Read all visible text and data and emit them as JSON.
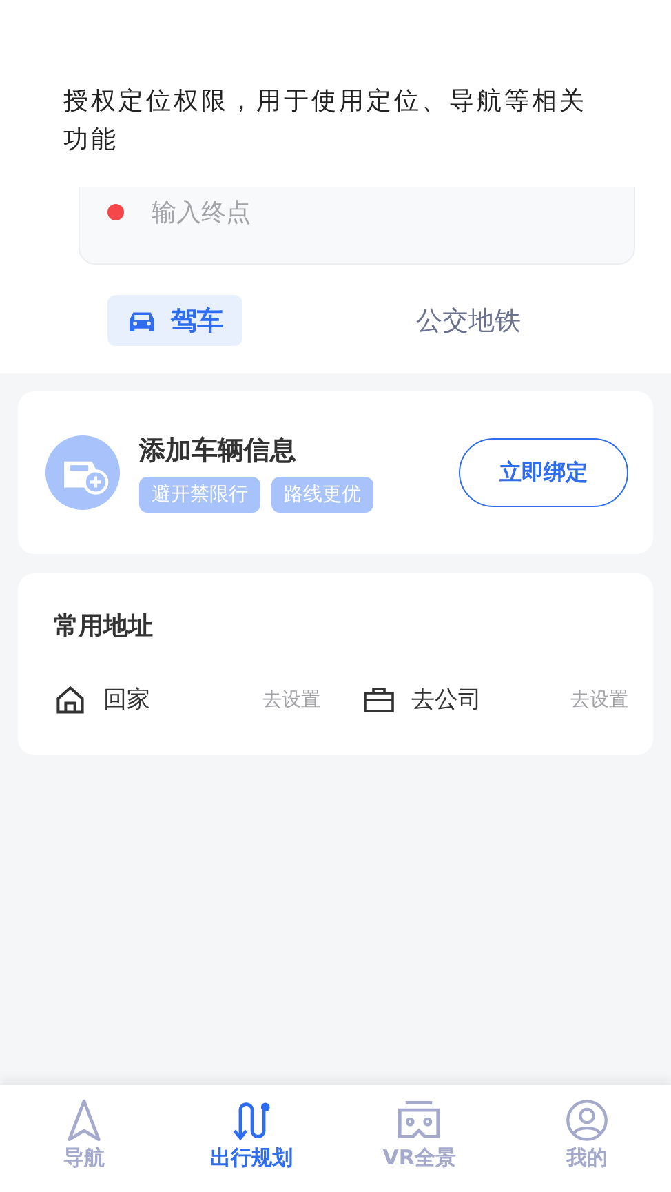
{
  "permission_notice": "授权定位权限，用于使用定位、导航等相关功能",
  "route": {
    "destination_placeholder": "输入终点"
  },
  "mode_tabs": [
    {
      "label": "驾车",
      "selected": true
    },
    {
      "label": "公交地铁",
      "selected": false
    }
  ],
  "vehicle_card": {
    "title": "添加车辆信息",
    "tags": [
      "避开禁限行",
      "路线更优"
    ],
    "button": "立即绑定"
  },
  "addresses": {
    "title": "常用地址",
    "items": [
      {
        "kind": "home",
        "label": "回家",
        "action": "去设置"
      },
      {
        "kind": "work",
        "label": "去公司",
        "action": "去设置"
      }
    ]
  },
  "bottom_nav": [
    {
      "kind": "navigate",
      "label": "导航",
      "selected": false
    },
    {
      "kind": "plan",
      "label": "出行规划",
      "selected": true
    },
    {
      "kind": "vr",
      "label": "VR全景",
      "selected": false
    },
    {
      "kind": "me",
      "label": "我的",
      "selected": false
    }
  ]
}
